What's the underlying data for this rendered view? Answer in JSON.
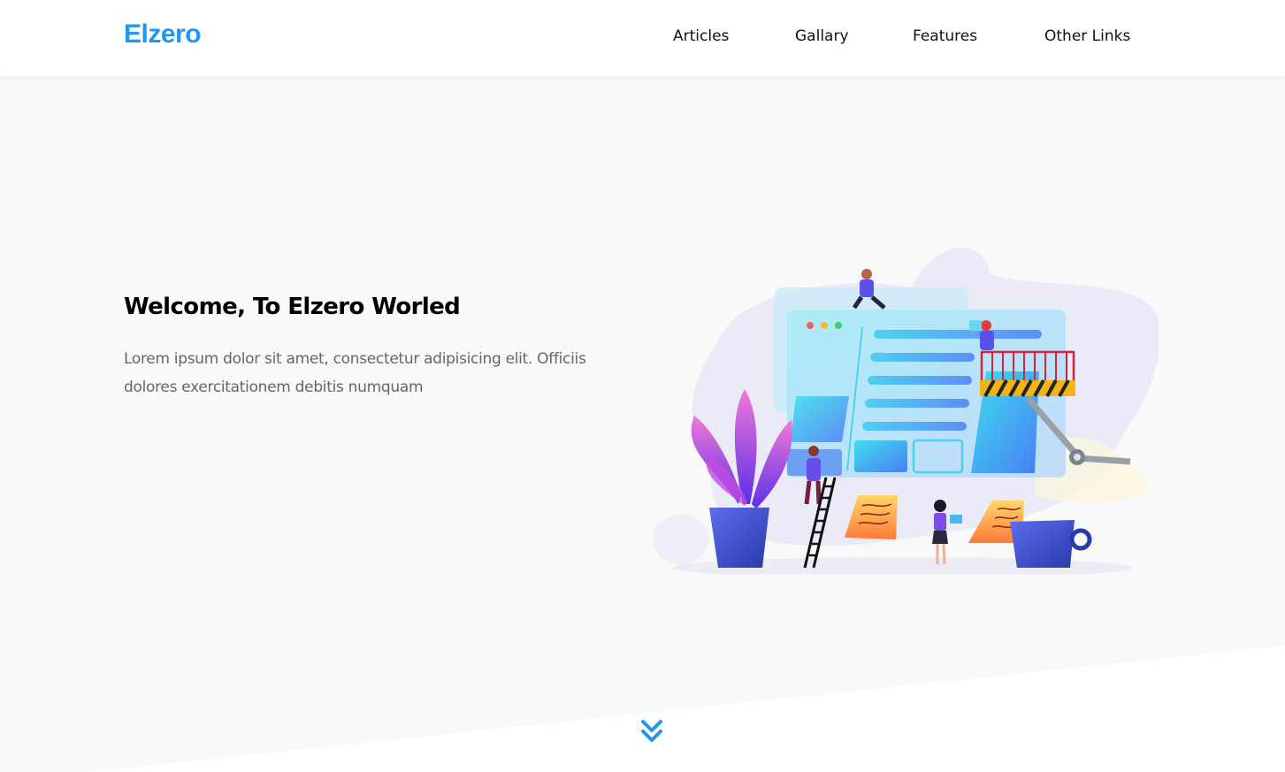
{
  "header": {
    "logo": "Elzero",
    "nav": [
      "Articles",
      "Gallary",
      "Features",
      "Other Links"
    ]
  },
  "hero": {
    "title": "Welcome, To Elzero Worled",
    "text": "Lorem ipsum dolor sit amet, consectetur adipisicing elit. Officiis dolores exercitationem debitis numquam"
  },
  "colors": {
    "accent": "#2196f3",
    "page_bg": "#f9f9fa"
  },
  "icons": {
    "scroll_down": "double-chevron-down-icon"
  }
}
